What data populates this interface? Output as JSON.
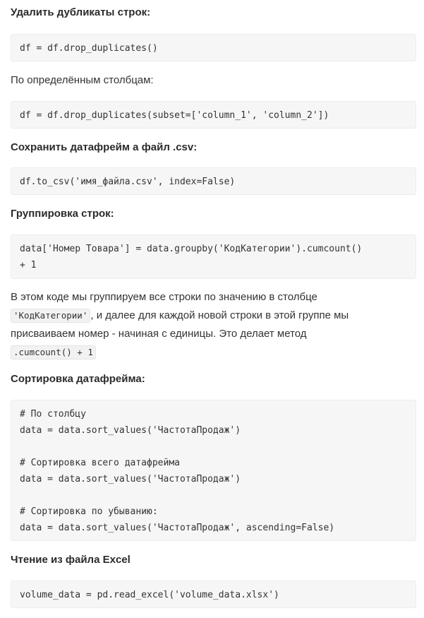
{
  "sections": {
    "drop_duplicates": {
      "heading": "Удалить дубликаты строк:",
      "code": [
        "df = df.drop_duplicates()"
      ],
      "subtext": "По определённым столбцам:",
      "code2": [
        "df = df.drop_duplicates(subset=['column_1', 'column_2'])"
      ]
    },
    "save_csv": {
      "heading": "Сохранить датафрейм а файл .csv:",
      "code": [
        "df.to_csv('имя_файла.csv', index=False)"
      ]
    },
    "grouping": {
      "heading": "Группировка строк:",
      "code": [
        "data['Номер Товара'] = data.groupby('КодКатегории').cumcount()",
        "+ 1"
      ],
      "para_line1": "В этом коде мы группируем все строки по значению в столбце",
      "inline_code1": "'КодКатегории'",
      "para_line2_rest": ", и далее для каждой новой строки в этой группе мы",
      "para_line3": "присваиваем номер - начиная с единицы. Это делает метод",
      "inline_code2": ".cumcount() + 1"
    },
    "sorting": {
      "heading": "Сортировка датафрейма:",
      "code": [
        "# По столбцу",
        "data = data.sort_values('ЧастотаПродаж')",
        "",
        "# Сортировка всего датафрейма",
        "data = data.sort_values('ЧастотаПродаж')",
        "",
        "# Сортировка по убыванию:",
        "data = data.sort_values('ЧастотаПродаж', ascending=False)"
      ]
    },
    "read_excel": {
      "heading": "Чтение из файла Excel",
      "code": [
        "volume_data = pd.read_excel('volume_data.xlsx')"
      ]
    }
  }
}
